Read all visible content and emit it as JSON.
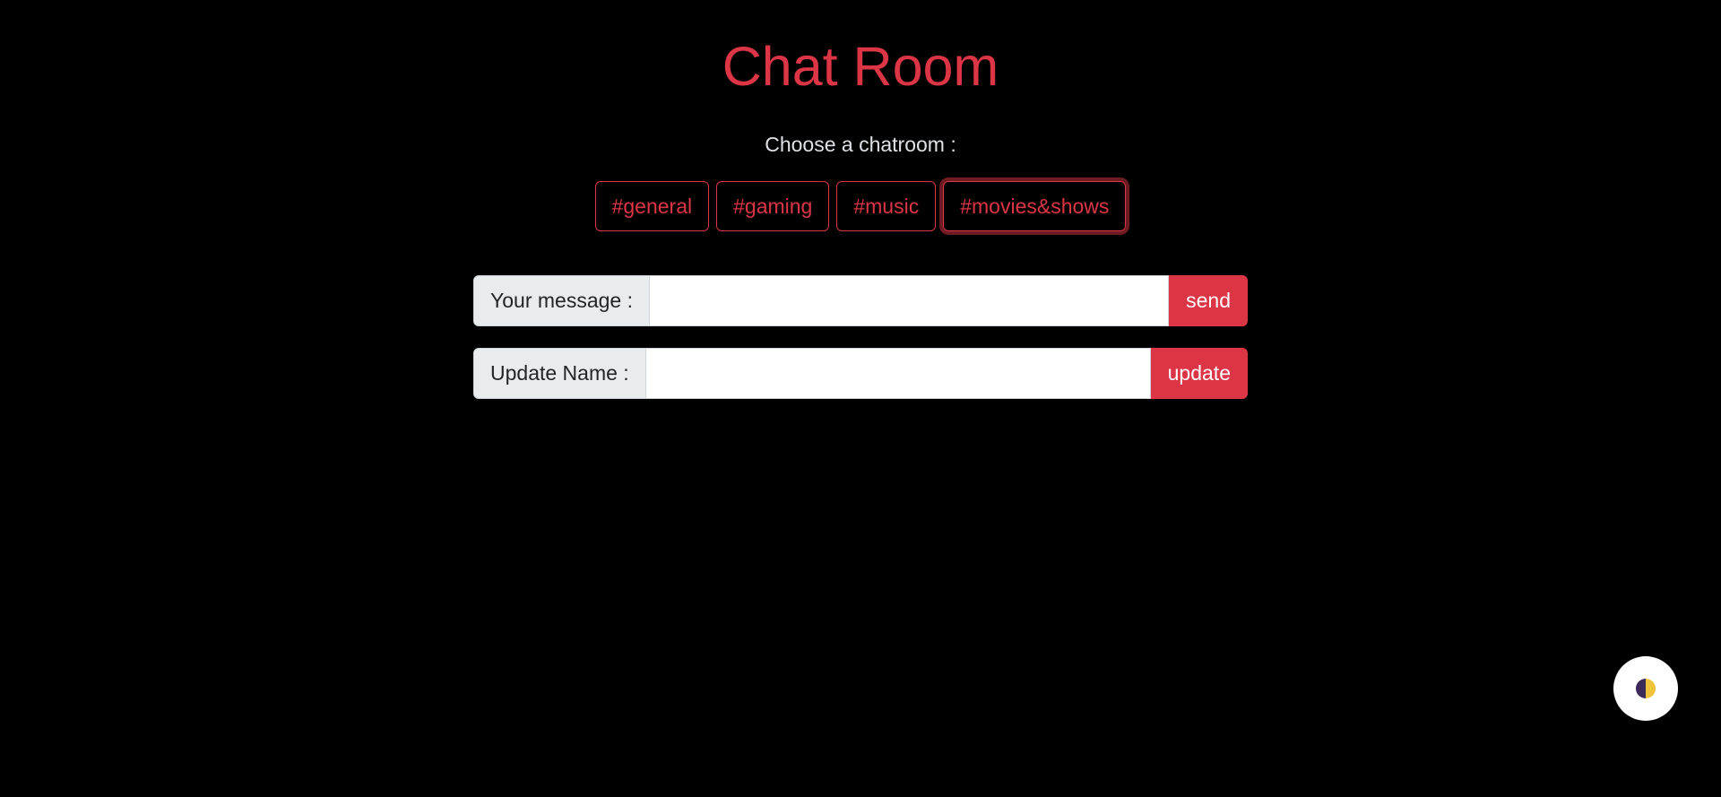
{
  "header": {
    "title": "Chat Room",
    "subtitle": "Choose a chatroom :"
  },
  "rooms": [
    {
      "label": "#general",
      "active": false
    },
    {
      "label": "#gaming",
      "active": false
    },
    {
      "label": "#music",
      "active": false
    },
    {
      "label": "#movies&shows",
      "active": true
    }
  ],
  "message": {
    "label": "Your message :",
    "value": "",
    "placeholder": "",
    "button": "send"
  },
  "name": {
    "label": "Update Name :",
    "value": "",
    "placeholder": "",
    "button": "update"
  },
  "theme_toggle": {
    "icon": "half-moon-icon",
    "colors": {
      "dark": "#3b2a57",
      "light": "#f0c43a"
    }
  },
  "colors": {
    "accent": "#dc3545",
    "background": "#000000",
    "label_bg": "#e9ecef"
  }
}
